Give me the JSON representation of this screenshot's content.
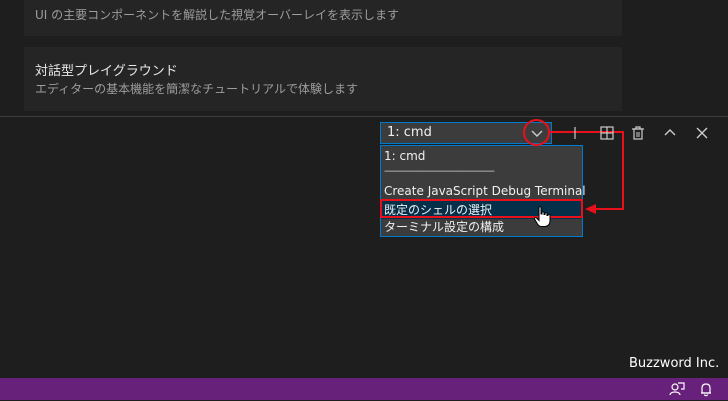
{
  "editor": {
    "card1": {
      "description": "UI の主要コンポーネントを解説した視覚オーバーレイを表示します"
    },
    "card2": {
      "title": "対話型プレイグラウンド",
      "description": "エディターの基本機能を簡潔なチュートリアルで体験します"
    }
  },
  "terminal": {
    "selected": "1: cmd",
    "options": [
      "1: cmd",
      "———————————",
      "Create JavaScript Debug Terminal",
      "既定のシェルの選択",
      "ターミナル設定の構成"
    ],
    "highlighted_index": 3
  },
  "toolbar_icons": [
    "chevron-down-icon",
    "split-terminal-icon",
    "trash-icon",
    "chevron-up-icon",
    "close-icon"
  ],
  "status_bar_icons": [
    "feedback-icon",
    "bell-icon"
  ],
  "watermark": "Buzzword Inc.",
  "colors": {
    "background": "#1e1e1e",
    "card": "#252526",
    "accent": "#007acc",
    "status_bar": "#68217a",
    "highlight": "#e8101b",
    "selection": "#062f4a"
  }
}
